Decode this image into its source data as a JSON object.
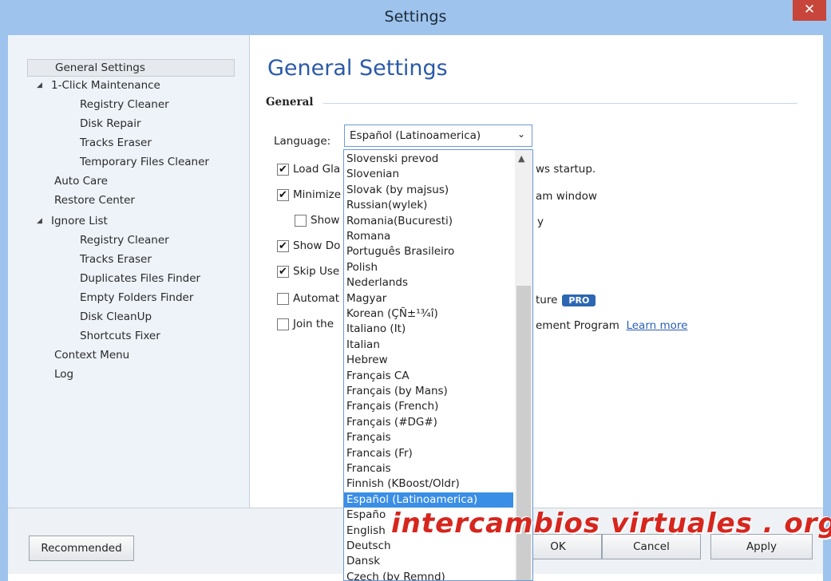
{
  "window": {
    "title": "Settings",
    "close_glyph": "✕"
  },
  "sidebar": {
    "items": [
      {
        "label": "General Settings",
        "selected": true
      },
      {
        "label": "1-Click Maintenance",
        "expanded": true
      },
      {
        "label": "Registry Cleaner"
      },
      {
        "label": "Disk Repair"
      },
      {
        "label": "Tracks Eraser"
      },
      {
        "label": "Temporary Files Cleaner"
      },
      {
        "label": "Auto Care"
      },
      {
        "label": "Restore Center"
      },
      {
        "label": "Ignore List",
        "expanded": true
      },
      {
        "label": "Registry Cleaner"
      },
      {
        "label": "Tracks Eraser"
      },
      {
        "label": "Duplicates Files Finder"
      },
      {
        "label": "Empty Folders Finder"
      },
      {
        "label": "Disk CleanUp"
      },
      {
        "label": "Shortcuts Fixer"
      },
      {
        "label": "Context Menu"
      },
      {
        "label": "Log"
      }
    ]
  },
  "main": {
    "title": "General Settings",
    "section": "General",
    "language_label": "Language:",
    "language_value": "Español (Latinoamerica)",
    "options": [
      {
        "text": "Load Gla",
        "suffix": "ws startup.",
        "checked": true
      },
      {
        "text": "Minimize",
        "suffix": "am window",
        "checked": true
      },
      {
        "text": "Show",
        "suffix": "y",
        "checked": false
      },
      {
        "text": "Show Do",
        "checked": true
      },
      {
        "text": "Skip Use",
        "checked": true
      },
      {
        "text": "Automat",
        "suffix": "ture",
        "badge": "PRO",
        "checked": false
      },
      {
        "text": "Join the",
        "suffix": "ement Program",
        "link": "Learn more",
        "checked": false
      }
    ]
  },
  "dropdown": {
    "items": [
      "Slovenski prevod",
      "Slovenian",
      "Slovak (by majsus)",
      "Russian(wylek)",
      "Romania(Bucuresti)",
      "Romana",
      "Português Brasileiro",
      "Polish",
      "Nederlands",
      "Magyar",
      "Korean (ÇÑ±¹¾î)",
      "Italiano (It)",
      "Italian",
      "Hebrew",
      "Français CA",
      "Français (by Mans)",
      "Français (French)",
      "Français (#DG#)",
      "Français",
      "Francais (Fr)",
      "Francais",
      "Finnish (KBoost/Oldr)",
      "Español (Latinoamerica)",
      "Españo",
      "English",
      "Deutsch",
      "Dansk",
      "Czech (by Remnd)"
    ],
    "selected": "Español (Latinoamerica)"
  },
  "footer": {
    "recommended": "Recommended",
    "ok": "OK",
    "cancel": "Cancel",
    "apply": "Apply"
  },
  "watermark": "intercambios virtuales . org",
  "colors": {
    "title_bar": "#9ec3ec",
    "accent": "#2a5aa8",
    "close": "#c7453a",
    "selection": "#3a8ee6",
    "pro_badge": "#2d67b3"
  }
}
